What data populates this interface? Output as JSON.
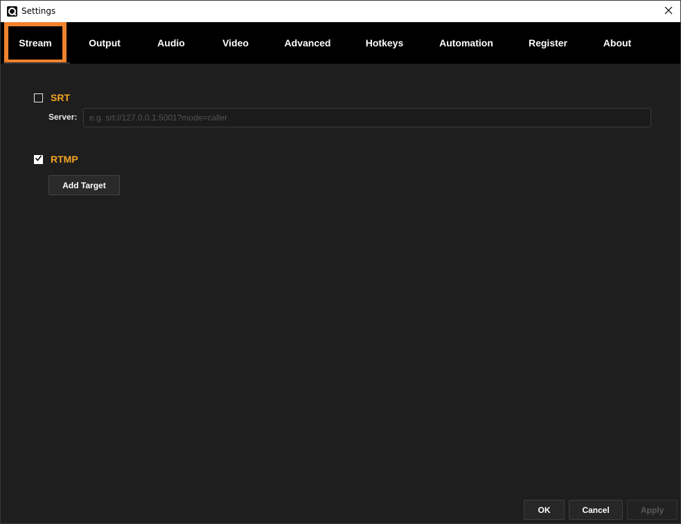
{
  "window": {
    "title": "Settings"
  },
  "tabs": [
    {
      "label": "Stream",
      "active": true
    },
    {
      "label": "Output",
      "active": false
    },
    {
      "label": "Audio",
      "active": false
    },
    {
      "label": "Video",
      "active": false
    },
    {
      "label": "Advanced",
      "active": false
    },
    {
      "label": "Hotkeys",
      "active": false
    },
    {
      "label": "Automation",
      "active": false
    },
    {
      "label": "Register",
      "active": false
    },
    {
      "label": "About",
      "active": false
    }
  ],
  "stream": {
    "srt": {
      "label": "SRT",
      "checked": false,
      "server_label": "Server:",
      "server_value": "",
      "server_placeholder": "e.g. srt://127.0.0.1:5001?mode=caller"
    },
    "rtmp": {
      "label": "RTMP",
      "checked": true,
      "add_target_label": "Add Target"
    }
  },
  "footer": {
    "ok_label": "OK",
    "cancel_label": "Cancel",
    "apply_label": "Apply",
    "apply_enabled": false
  },
  "colors": {
    "accent_orange": "#f5a623",
    "active_tab_border": "#f0822d",
    "background": "#1e1e1e",
    "tabbar": "#000000"
  },
  "icons": {
    "app": "app-logo-icon",
    "close": "close-icon",
    "check": "checkmark-icon"
  }
}
